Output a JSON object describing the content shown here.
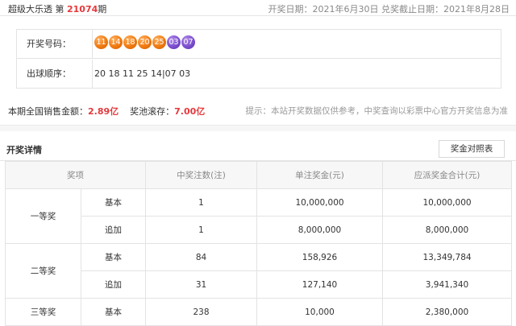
{
  "topbar": {
    "lottery_name": "超级大乐透",
    "issue_prefix": "第",
    "issue_number": "21074",
    "issue_suffix": "期",
    "draw_date": "开奖日期：2021年6月30日",
    "deadline": "兑奖截止日期：2021年8月28日"
  },
  "info": {
    "numbers_label": "开奖号码：",
    "red_balls": [
      "11",
      "14",
      "18",
      "20",
      "25"
    ],
    "blue_balls": [
      "03",
      "07"
    ],
    "order_label": "出球顺序：",
    "order_value": "20 18 11 25 14|07 03"
  },
  "sales": {
    "sales_label": "本期全国销售金额：",
    "sales_value": "2.89亿",
    "pool_label": "奖池滚存：",
    "pool_value": "7.00亿",
    "notice": "提示：本站开奖数据仅供参考，中奖查询以彩票中心官方开奖信息为准"
  },
  "details": {
    "title": "开奖详情",
    "table_button": "奖金对照表",
    "headers": [
      "奖项",
      "中奖注数(注)",
      "单注奖金(元)",
      "应派奖金合计(元)"
    ],
    "prizes": [
      {
        "name": "一等奖",
        "rows": [
          {
            "type": "基本",
            "count": "1",
            "single": "10,000,000",
            "total": "10,000,000"
          },
          {
            "type": "追加",
            "count": "1",
            "single": "8,000,000",
            "total": "8,000,000"
          }
        ]
      },
      {
        "name": "二等奖",
        "rows": [
          {
            "type": "基本",
            "count": "84",
            "single": "158,926",
            "total": "13,349,784"
          },
          {
            "type": "追加",
            "count": "31",
            "single": "127,140",
            "total": "3,941,340"
          }
        ]
      },
      {
        "name": "三等奖",
        "rows": [
          {
            "type": "基本",
            "count": "238",
            "single": "10,000",
            "total": "2,380,000"
          }
        ]
      }
    ]
  }
}
